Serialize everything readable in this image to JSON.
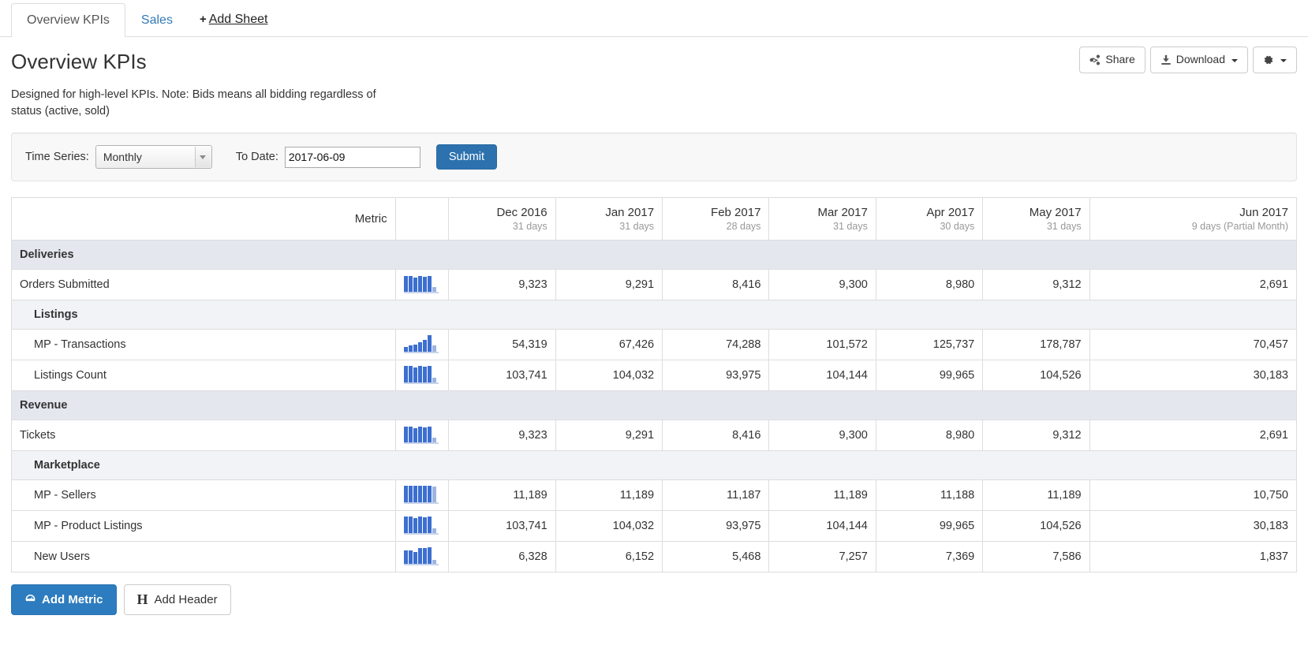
{
  "tabs": [
    {
      "label": "Overview KPIs",
      "active": true
    },
    {
      "label": "Sales",
      "active": false
    }
  ],
  "add_sheet": {
    "plus": "+",
    "label": "Add Sheet"
  },
  "header": {
    "title": "Overview KPIs",
    "description": "Designed for high-level KPIs. Note: Bids means all bidding regardless of status (active, sold)",
    "share_label": "Share",
    "download_label": "Download"
  },
  "filters": {
    "time_series_label": "Time Series:",
    "time_series_value": "Monthly",
    "time_series_options": [
      "Monthly"
    ],
    "to_date_label": "To Date:",
    "to_date_value": "2017-06-09",
    "submit_label": "Submit"
  },
  "table": {
    "metric_header": "Metric",
    "columns": [
      {
        "name": "Dec 2016",
        "sub": "31 days"
      },
      {
        "name": "Jan 2017",
        "sub": "31 days"
      },
      {
        "name": "Feb 2017",
        "sub": "28 days"
      },
      {
        "name": "Mar 2017",
        "sub": "31 days"
      },
      {
        "name": "Apr 2017",
        "sub": "30 days"
      },
      {
        "name": "May 2017",
        "sub": "31 days"
      },
      {
        "name": "Jun 2017",
        "sub": "9 days (Partial Month)"
      }
    ],
    "rows": [
      {
        "type": "group",
        "level": 1,
        "label": "Deliveries"
      },
      {
        "type": "metric",
        "level": 1,
        "label": "Orders Submitted",
        "spark": [
          0.95,
          0.95,
          0.86,
          0.95,
          0.92,
          0.95,
          0.28
        ],
        "values": [
          "9,323",
          "9,291",
          "8,416",
          "9,300",
          "8,980",
          "9,312",
          "2,691"
        ]
      },
      {
        "type": "group",
        "level": 2,
        "label": "Listings"
      },
      {
        "type": "metric",
        "level": 2,
        "label": "MP - Transactions",
        "spark": [
          0.3,
          0.38,
          0.42,
          0.57,
          0.7,
          1.0,
          0.39
        ],
        "values": [
          "54,319",
          "67,426",
          "74,288",
          "101,572",
          "125,737",
          "178,787",
          "70,457"
        ]
      },
      {
        "type": "metric",
        "level": 2,
        "label": "Listings Count",
        "spark": [
          0.99,
          1.0,
          0.9,
          1.0,
          0.96,
          1.0,
          0.29
        ],
        "values": [
          "103,741",
          "104,032",
          "93,975",
          "104,144",
          "99,965",
          "104,526",
          "30,183"
        ]
      },
      {
        "type": "group",
        "level": 1,
        "label": "Revenue"
      },
      {
        "type": "metric",
        "level": 1,
        "label": "Tickets",
        "spark": [
          0.95,
          0.95,
          0.86,
          0.95,
          0.92,
          0.95,
          0.28
        ],
        "values": [
          "9,323",
          "9,291",
          "8,416",
          "9,300",
          "8,980",
          "9,312",
          "2,691"
        ]
      },
      {
        "type": "group",
        "level": 2,
        "label": "Marketplace"
      },
      {
        "type": "metric",
        "level": 2,
        "label": "MP - Sellers",
        "spark": [
          1.0,
          1.0,
          1.0,
          1.0,
          1.0,
          1.0,
          0.96
        ],
        "values": [
          "11,189",
          "11,189",
          "11,187",
          "11,189",
          "11,188",
          "11,189",
          "10,750"
        ]
      },
      {
        "type": "metric",
        "level": 2,
        "label": "MP - Product Listings",
        "spark": [
          0.99,
          1.0,
          0.9,
          1.0,
          0.96,
          1.0,
          0.29
        ],
        "values": [
          "103,741",
          "104,032",
          "93,975",
          "104,144",
          "99,965",
          "104,526",
          "30,183"
        ]
      },
      {
        "type": "metric",
        "level": 2,
        "label": "New Users",
        "spark": [
          0.83,
          0.81,
          0.72,
          0.96,
          0.97,
          1.0,
          0.24
        ],
        "values": [
          "6,328",
          "6,152",
          "5,468",
          "7,257",
          "7,369",
          "7,586",
          "1,837"
        ]
      }
    ]
  },
  "footer": {
    "add_metric_label": "Add Metric",
    "add_header_label": "Add Header",
    "add_header_glyph": "H"
  },
  "colors": {
    "primary": "#2d7cbf",
    "submit": "#2d72ae",
    "link": "#337ab7",
    "spark_bar": "#3c6fd0",
    "spark_last": "#9db4e2",
    "group_a_bg": "#e5e7ef",
    "group_b_bg": "#f2f3f7"
  }
}
